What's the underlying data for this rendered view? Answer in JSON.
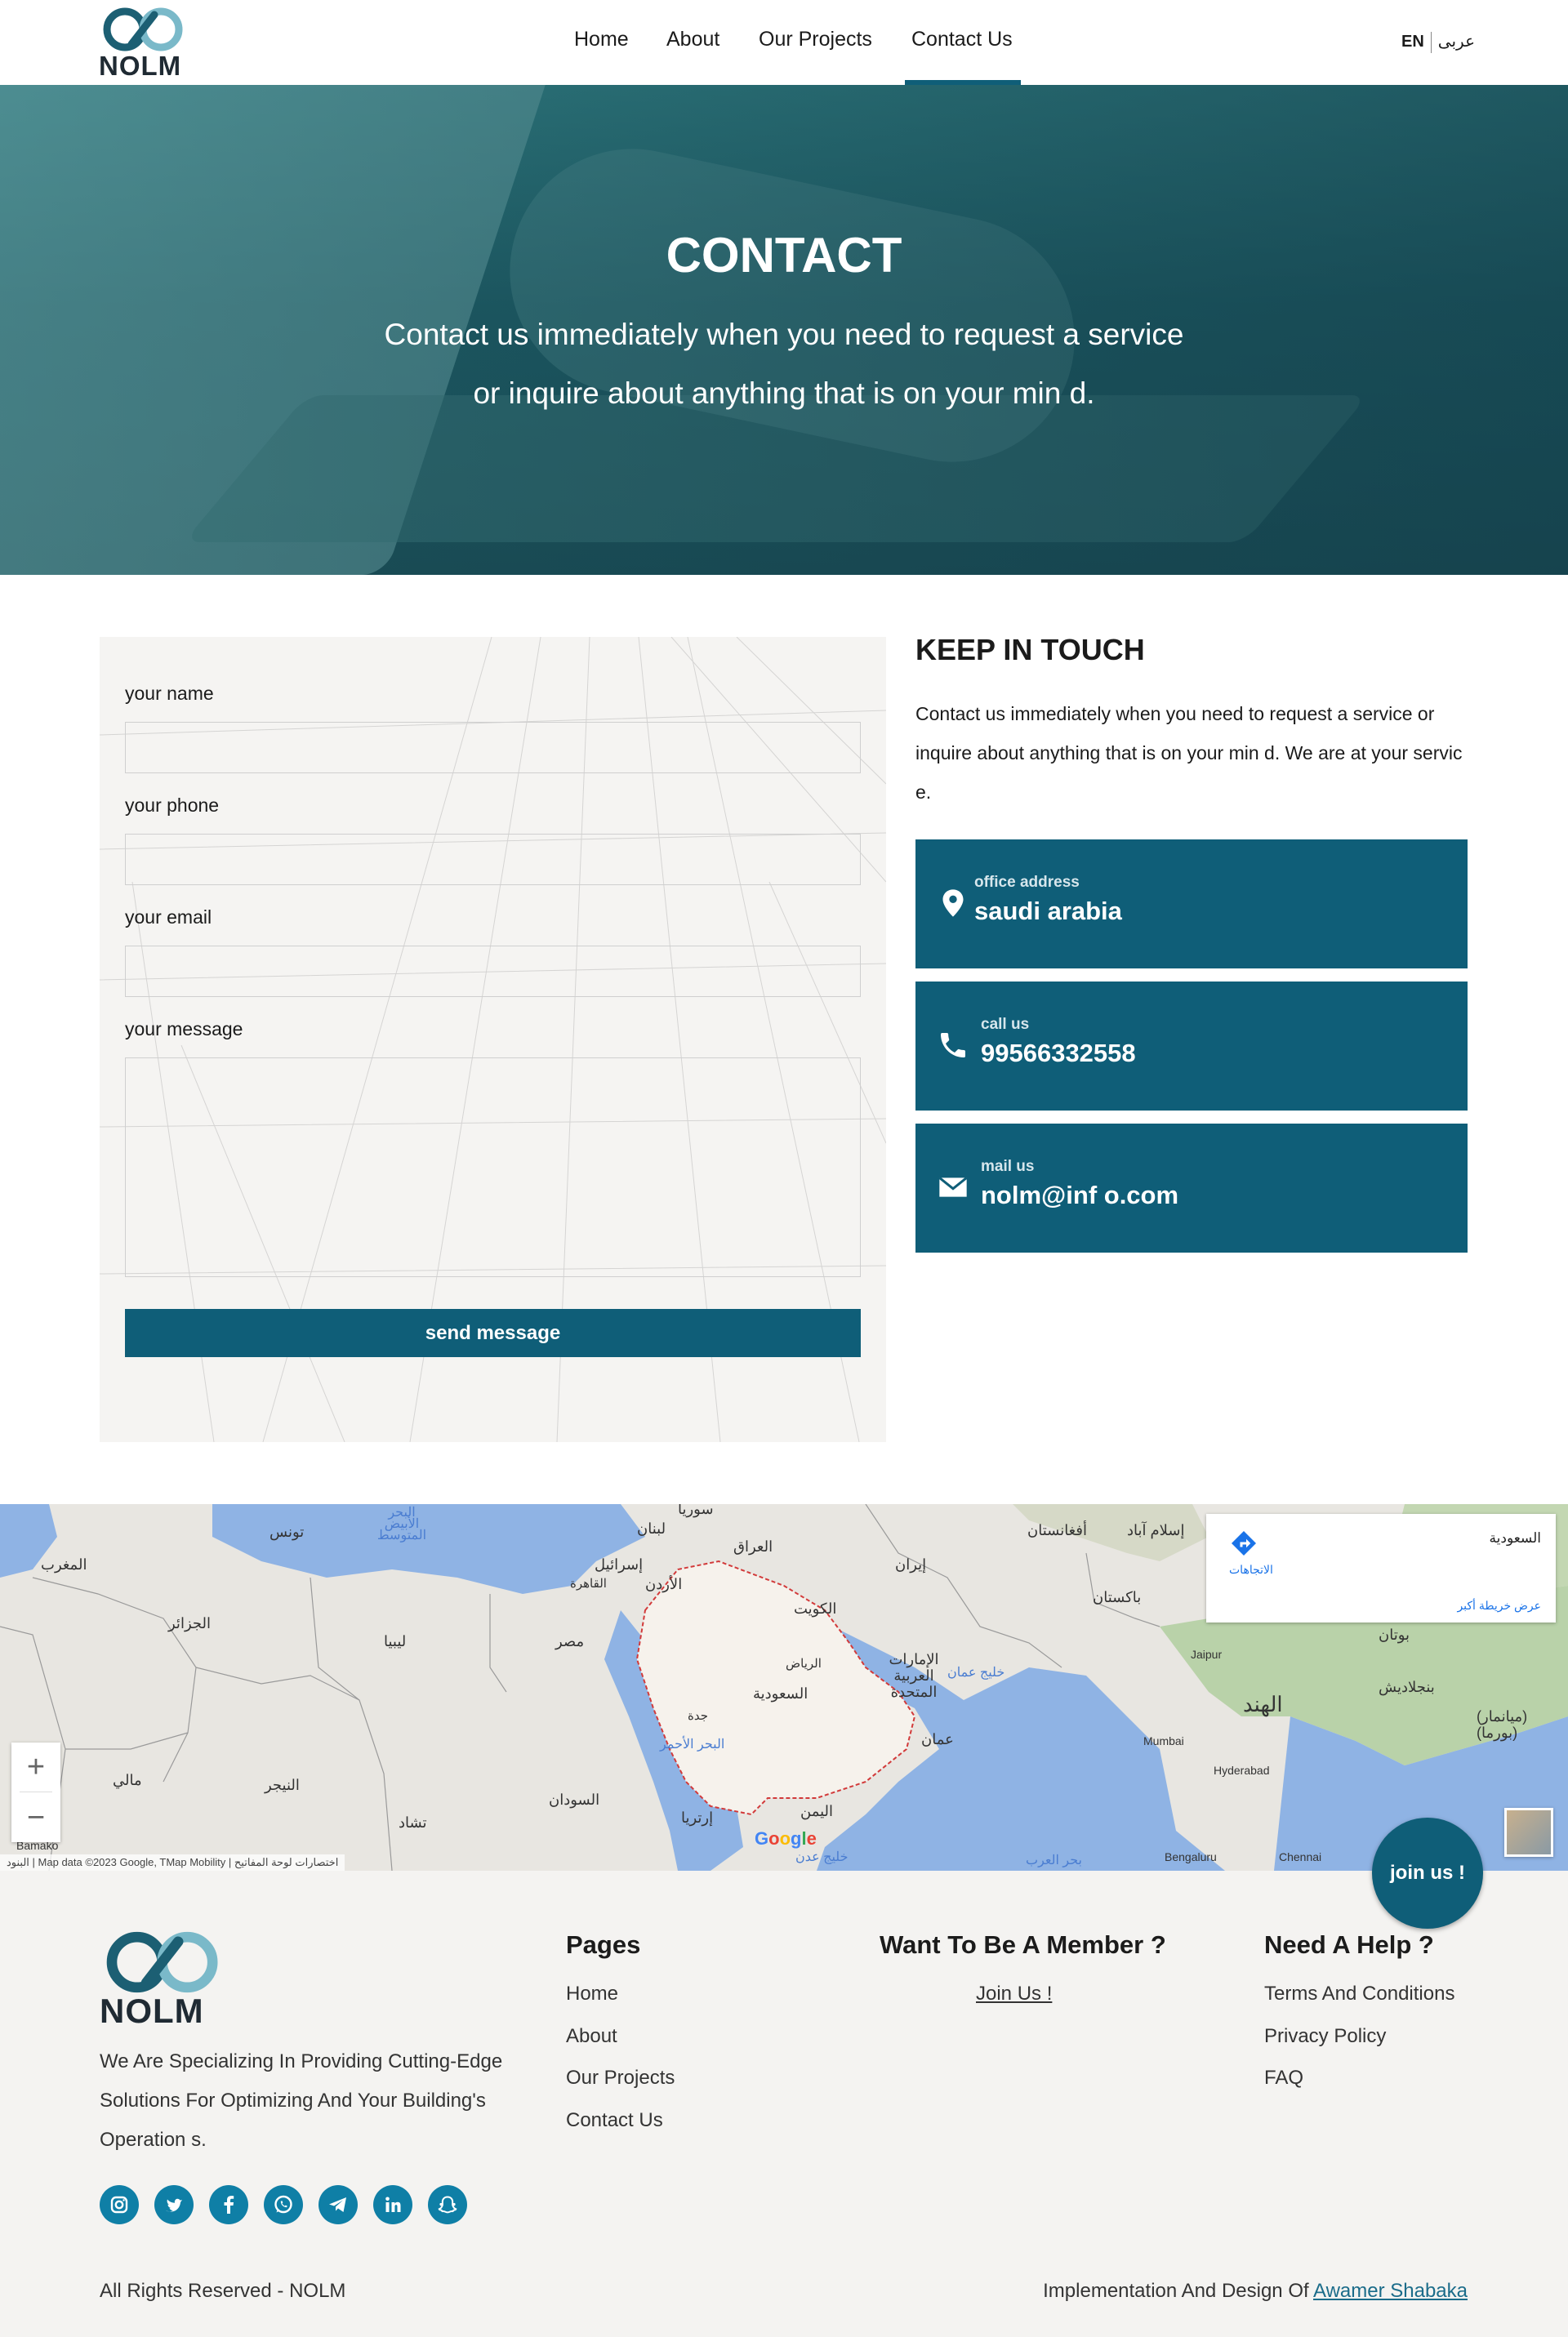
{
  "nav": {
    "brand": "NOLM",
    "links": [
      "Home",
      "About",
      "Our Projects",
      "Contact Us"
    ],
    "active": "Contact Us",
    "lang_en": "EN",
    "lang_ar": "عربى"
  },
  "hero": {
    "title": "CONTACT",
    "subtitle": "Contact us immediately when you need to request a service or inquire about anything that is on your min d."
  },
  "form": {
    "name_label": "your name",
    "phone_label": "your phone",
    "email_label": "your email",
    "message_label": "your message",
    "name_value": "",
    "phone_value": "",
    "email_value": "",
    "message_value": "",
    "submit_label": "send message"
  },
  "keep_in_touch": {
    "title": "KEEP IN TOUCH",
    "text": "Contact us immediately when you need to request a service or inquire about anything that is on your min d. We are at your servic e.",
    "cards": [
      {
        "icon": "location-pin-icon",
        "label": "office address",
        "value": "saudi arabia"
      },
      {
        "icon": "phone-icon",
        "label": "call us",
        "value": "99566332558"
      },
      {
        "icon": "mail-icon",
        "label": "mail us",
        "value": "nolm@inf o.com"
      }
    ]
  },
  "map": {
    "country_card_title": "السعودية",
    "directions_label": "الاتجاهات",
    "bigger_map_label": "عرض خريطة أكبر",
    "zoom_in": "+",
    "zoom_out": "−",
    "attribution": "Map data ©2023 Google, TMap Mobility",
    "shortcuts": "اختصارات لوحة المفاتيح",
    "terms": "البنود",
    "google": "Google",
    "labels": {
      "syria": "سوريا",
      "lebanon": "لبنان",
      "iraq": "العراق",
      "afghanistan": "أفغانستان",
      "islamabad": "إسلام آباد",
      "tunisia": "تونس",
      "med_sea": "البحر الأبيض المتوسط",
      "morocco": "المغرب",
      "israel": "إسرائيل",
      "jordan": "الأردن",
      "cairo": "القاهرة",
      "iran": "إيران",
      "kuwait": "الكويت",
      "pakistan": "باكستان",
      "algeria": "الجزائر",
      "libya": "ليبيا",
      "egypt": "مصر",
      "riyadh": "الرياض",
      "saudi": "السعودية",
      "uae": "الإمارات العربية المتحدة",
      "oman_gulf": "خليج عمان",
      "oman": "عمان",
      "jaipur": "Jaipur",
      "india": "الهند",
      "bangladesh": "بنجلاديش",
      "myanmar": "(ميانمار) (بورما)",
      "bhutan": "بوتان",
      "jeddah": "جدة",
      "red_sea": "البحر الأحمر",
      "mali": "مالي",
      "niger": "النيجر",
      "sudan": "السودان",
      "chad": "تشاد",
      "eritrea": "إرتريا",
      "yemen": "اليمن",
      "mumbai": "Mumbai",
      "hyderabad": "Hyderabad",
      "bengaluru": "Bengaluru",
      "chennai": "Chennai",
      "bamako": "Bamako",
      "aden_gulf": "خليج عدن",
      "arabian_sea": "بحر العرب"
    }
  },
  "join_fab": "join us !",
  "footer": {
    "brand": "NOLM",
    "about": "We Are Specializing In Providing Cutting-Edge Solutions For Optimizing And Your Building's Operation s.",
    "socials": [
      "instagram-icon",
      "twitter-icon",
      "facebook-icon",
      "whatsapp-icon",
      "telegram-icon",
      "linkedin-icon",
      "snapchat-icon"
    ],
    "pages_heading": "Pages",
    "pages": [
      "Home",
      "About",
      "Our Projects",
      "Contact Us"
    ],
    "member_heading": "Want To Be A Member ?",
    "member_link": "Join Us !",
    "help_heading": "Need A Help ?",
    "help_links": [
      "Terms And Conditions",
      "Privacy Policy",
      "FAQ"
    ],
    "copyright": "All Rights Reserved - NOLM",
    "impl_prefix": "Implementation And Design Of",
    "impl_link": "Awamer Shabaka"
  },
  "colors": {
    "primary": "#0f5e78",
    "social": "#0f7fa6",
    "footer_bg": "#f4f3f1"
  }
}
